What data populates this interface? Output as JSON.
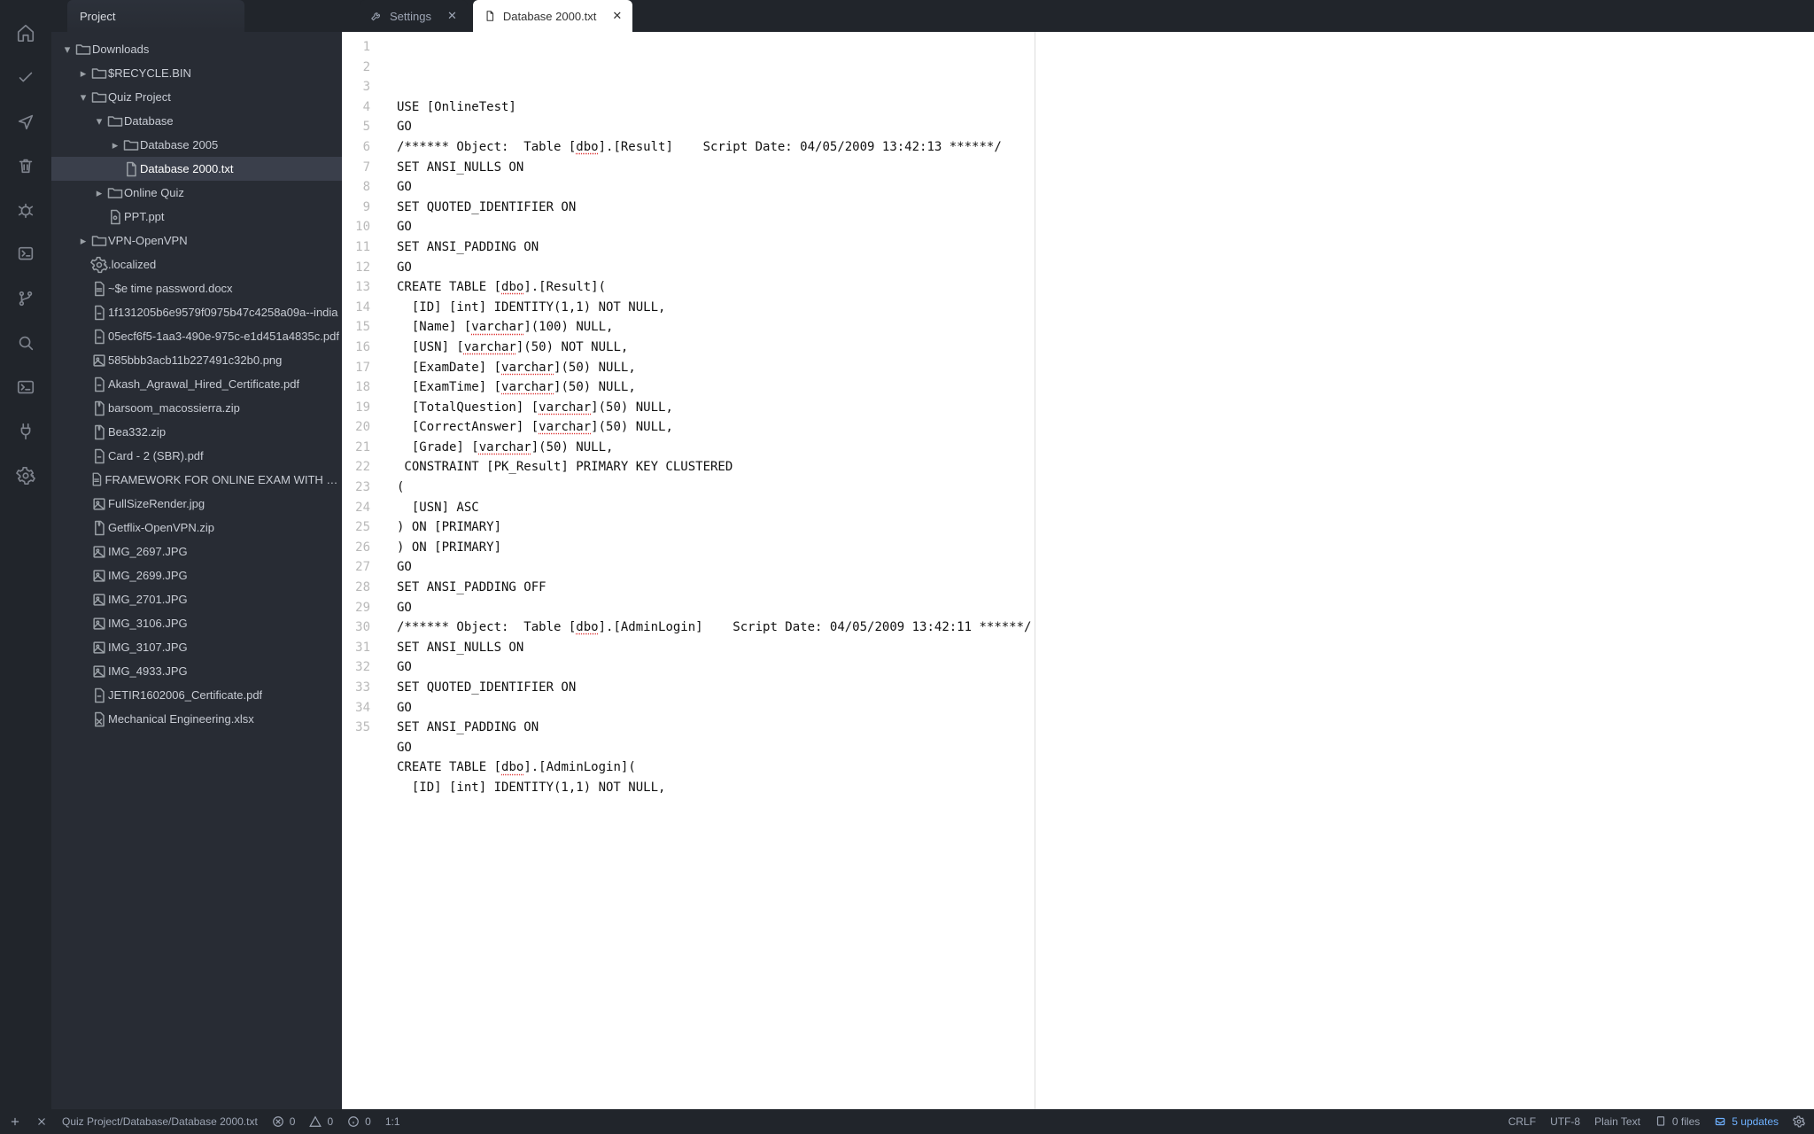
{
  "sidebar": {
    "title": "Project"
  },
  "activity": {
    "icons": [
      "home",
      "check",
      "share",
      "trash",
      "bug",
      "board",
      "branch",
      "search",
      "terminal",
      "plug",
      "gear"
    ]
  },
  "tree": [
    {
      "depth": 0,
      "chev": "down",
      "icon": "folder",
      "label": "Downloads"
    },
    {
      "depth": 1,
      "chev": "right",
      "icon": "folder",
      "label": "$RECYCLE.BIN"
    },
    {
      "depth": 1,
      "chev": "down",
      "icon": "folder",
      "label": "Quiz Project"
    },
    {
      "depth": 2,
      "chev": "down",
      "icon": "folder",
      "label": "Database"
    },
    {
      "depth": 3,
      "chev": "right",
      "icon": "folder",
      "label": "Database 2005"
    },
    {
      "depth": 3,
      "chev": "",
      "icon": "file",
      "label": "Database 2000.txt",
      "selected": true
    },
    {
      "depth": 2,
      "chev": "right",
      "icon": "folder",
      "label": "Online Quiz"
    },
    {
      "depth": 2,
      "chev": "",
      "icon": "ppt",
      "label": "PPT.ppt"
    },
    {
      "depth": 1,
      "chev": "right",
      "icon": "folder",
      "label": "VPN-OpenVPN"
    },
    {
      "depth": 1,
      "chev": "",
      "icon": "gear",
      "label": ".localized"
    },
    {
      "depth": 1,
      "chev": "",
      "icon": "doc",
      "label": "~$e time password.docx"
    },
    {
      "depth": 1,
      "chev": "",
      "icon": "pdf",
      "label": "1f131205b6e9579f0975b47c4258a09a--india"
    },
    {
      "depth": 1,
      "chev": "",
      "icon": "pdf",
      "label": "05ecf6f5-1aa3-490e-975c-e1d451a4835c.pdf"
    },
    {
      "depth": 1,
      "chev": "",
      "icon": "img",
      "label": "585bbb3acb11b227491c32b0.png"
    },
    {
      "depth": 1,
      "chev": "",
      "icon": "pdf",
      "label": "Akash_Agrawal_Hired_Certificate.pdf"
    },
    {
      "depth": 1,
      "chev": "",
      "icon": "zip",
      "label": "barsoom_macossierra.zip"
    },
    {
      "depth": 1,
      "chev": "",
      "icon": "zip",
      "label": "Bea332.zip"
    },
    {
      "depth": 1,
      "chev": "",
      "icon": "pdf",
      "label": "Card - 2 (SBR).pdf"
    },
    {
      "depth": 1,
      "chev": "",
      "icon": "doc",
      "label": "FRAMEWORK FOR ONLINE EXAM WITH GRAPH"
    },
    {
      "depth": 1,
      "chev": "",
      "icon": "img",
      "label": "FullSizeRender.jpg"
    },
    {
      "depth": 1,
      "chev": "",
      "icon": "zip",
      "label": "Getflix-OpenVPN.zip"
    },
    {
      "depth": 1,
      "chev": "",
      "icon": "img",
      "label": "IMG_2697.JPG"
    },
    {
      "depth": 1,
      "chev": "",
      "icon": "img",
      "label": "IMG_2699.JPG"
    },
    {
      "depth": 1,
      "chev": "",
      "icon": "img",
      "label": "IMG_2701.JPG"
    },
    {
      "depth": 1,
      "chev": "",
      "icon": "img",
      "label": "IMG_3106.JPG"
    },
    {
      "depth": 1,
      "chev": "",
      "icon": "img",
      "label": "IMG_3107.JPG"
    },
    {
      "depth": 1,
      "chev": "",
      "icon": "img",
      "label": "IMG_4933.JPG"
    },
    {
      "depth": 1,
      "chev": "",
      "icon": "pdf",
      "label": "JETIR1602006_Certificate.pdf"
    },
    {
      "depth": 1,
      "chev": "",
      "icon": "xls",
      "label": "Mechanical Engineering.xlsx"
    }
  ],
  "tabs": [
    {
      "label": "Settings",
      "icon": "wrench",
      "active": false,
      "closable": true
    },
    {
      "label": "Database 2000.txt",
      "icon": "file",
      "active": true,
      "closable": true
    }
  ],
  "code": [
    "USE [OnlineTest]",
    "GO",
    "/****** Object:  Table [<u>dbo</u>].[Result]    Script Date: 04/05/2009 13:42:13 ******/",
    "SET ANSI_NULLS ON",
    "GO",
    "SET QUOTED_IDENTIFIER ON",
    "GO",
    "SET ANSI_PADDING ON",
    "GO",
    "CREATE TABLE [<u>dbo</u>].[Result](",
    "  [ID] [int] IDENTITY(1,1) NOT NULL,",
    "  [Name] [<u>varchar</u>](100) NULL,",
    "  [USN] [<u>varchar</u>](50) NOT NULL,",
    "  [ExamDate] [<u>varchar</u>](50) NULL,",
    "  [ExamTime] [<u>varchar</u>](50) NULL,",
    "  [TotalQuestion] [<u>varchar</u>](50) NULL,",
    "  [CorrectAnswer] [<u>varchar</u>](50) NULL,",
    "  [Grade] [<u>varchar</u>](50) NULL,",
    " CONSTRAINT [PK_Result] PRIMARY KEY CLUSTERED ",
    "(",
    "  [USN] ASC",
    ") ON [PRIMARY]",
    ") ON [PRIMARY]",
    "GO",
    "SET ANSI_PADDING OFF",
    "GO",
    "/****** Object:  Table [<u>dbo</u>].[AdminLogin]    Script Date: 04/05/2009 13:42:11 ******/",
    "SET ANSI_NULLS ON",
    "GO",
    "SET QUOTED_IDENTIFIER ON",
    "GO",
    "SET ANSI_PADDING ON",
    "GO",
    "CREATE TABLE [<u>dbo</u>].[AdminLogin](",
    "  [ID] [int] IDENTITY(1,1) NOT NULL,"
  ],
  "status": {
    "path": "Quiz Project/Database/Database 2000.txt",
    "err": "0",
    "warn": "0",
    "info": "0",
    "pos": "1:1",
    "eol": "CRLF",
    "enc": "UTF-8",
    "files": "0 files",
    "updates": "5 updates",
    "lang": "Plain Text"
  }
}
